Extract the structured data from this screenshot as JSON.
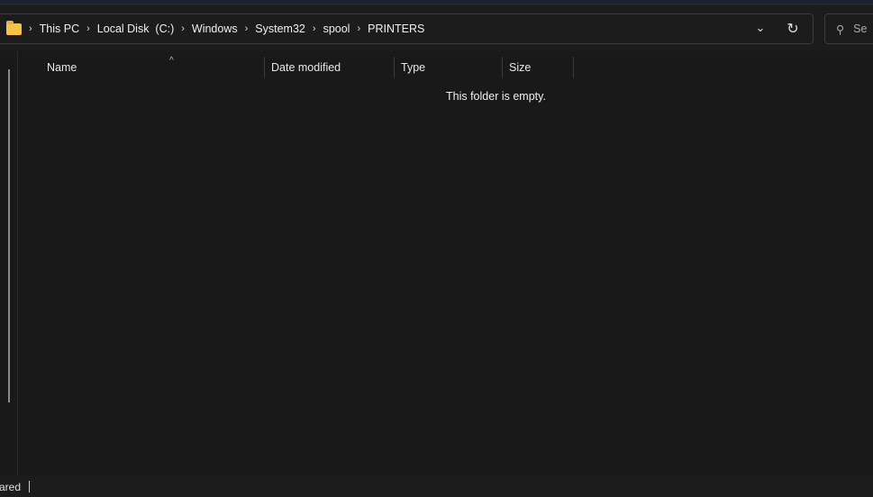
{
  "address_bar": {
    "breadcrumbs": [
      "This PC",
      "Local Disk  (C:)",
      "Windows",
      "System32",
      "spool",
      "PRINTERS"
    ]
  },
  "search": {
    "placeholder": "Se"
  },
  "columns": [
    "Name",
    "Date modified",
    "Type",
    "Size"
  ],
  "empty_message": "This folder is empty.",
  "status_bar": {
    "text": "ared"
  }
}
